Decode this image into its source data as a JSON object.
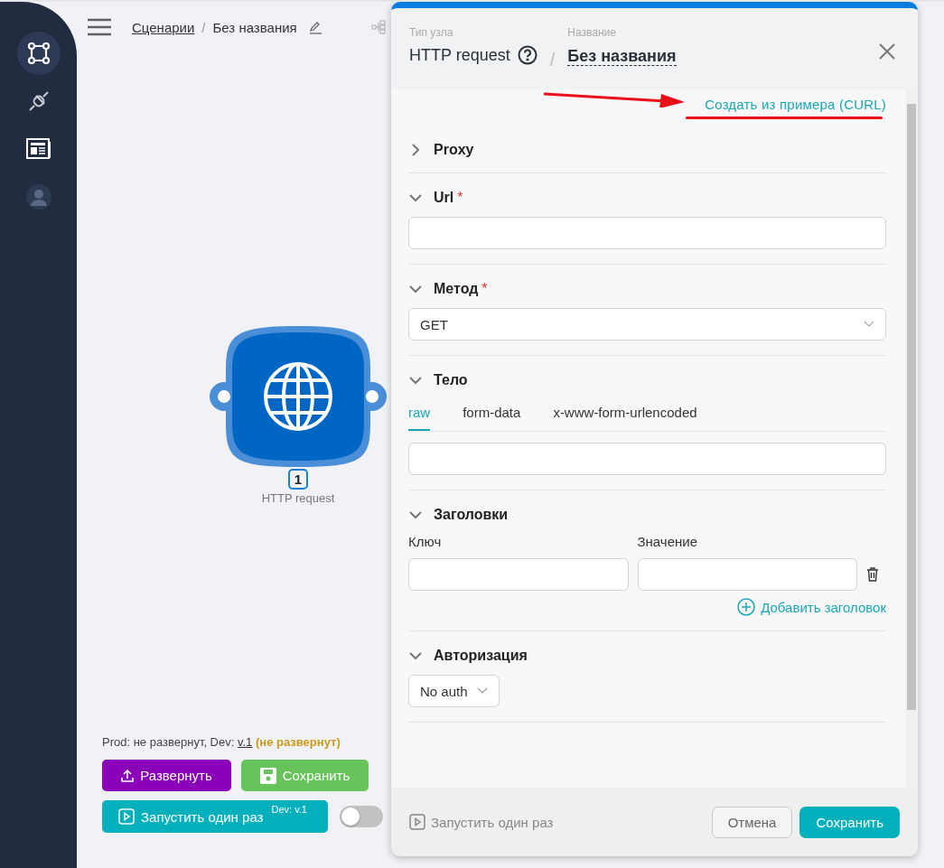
{
  "sidebar": {
    "items": [
      {
        "kind": "scenarios",
        "selected": true
      },
      {
        "kind": "connectors",
        "selected": false
      },
      {
        "kind": "docs",
        "selected": false
      },
      {
        "kind": "user",
        "selected": false
      }
    ]
  },
  "header": {
    "breadcrumb": "Сценарии",
    "separator": "/",
    "title": "Без названия"
  },
  "canvas": {
    "node": {
      "title": "HTTP request",
      "badge": "1"
    },
    "status": {
      "prefix": "Prod: не развернут, Dev:",
      "version": "v.1",
      "state": "(не развернут)"
    },
    "buttons": [
      {
        "kind": "deploy",
        "label": "Развернуть"
      },
      {
        "kind": "save",
        "label": "Сохранить"
      },
      {
        "kind": "run",
        "label": "Запустить один раз",
        "badge": "Dev: v.1"
      }
    ],
    "toggle": {
      "on": false
    }
  },
  "panel": {
    "type_label": "Тип узла",
    "type": "HTTP request",
    "separator": "/",
    "name_label": "Название",
    "name": "Без названия",
    "curl_link": "Создать из примера (CURL)",
    "sections": [
      {
        "title": "Proxy",
        "expanded": false
      },
      {
        "kind": "text",
        "title": "Url",
        "mark": "*",
        "expanded": true
      },
      {
        "kind": "select",
        "title": "Метод",
        "mark": "*",
        "expanded": true,
        "value": "GET"
      },
      {
        "kind": "body",
        "title": "Тело",
        "expanded": true,
        "tabs": [
          {
            "label": "raw",
            "selected": true
          },
          {
            "label": "form-data",
            "selected": false
          },
          {
            "label": "x-www-form-urlencoded",
            "selected": false
          }
        ]
      },
      {
        "kind": "headers",
        "title": "Заголовки",
        "expanded": true,
        "key_label": "Ключ",
        "value_label": "Значение",
        "add": "Добавить заголовок"
      },
      {
        "kind": "dropdown",
        "title": "Авторизация",
        "expanded": true,
        "value": "No auth"
      }
    ],
    "footer": {
      "run": "Запустить один раз",
      "cancel": "Отмена",
      "save": "Сохранить"
    }
  }
}
